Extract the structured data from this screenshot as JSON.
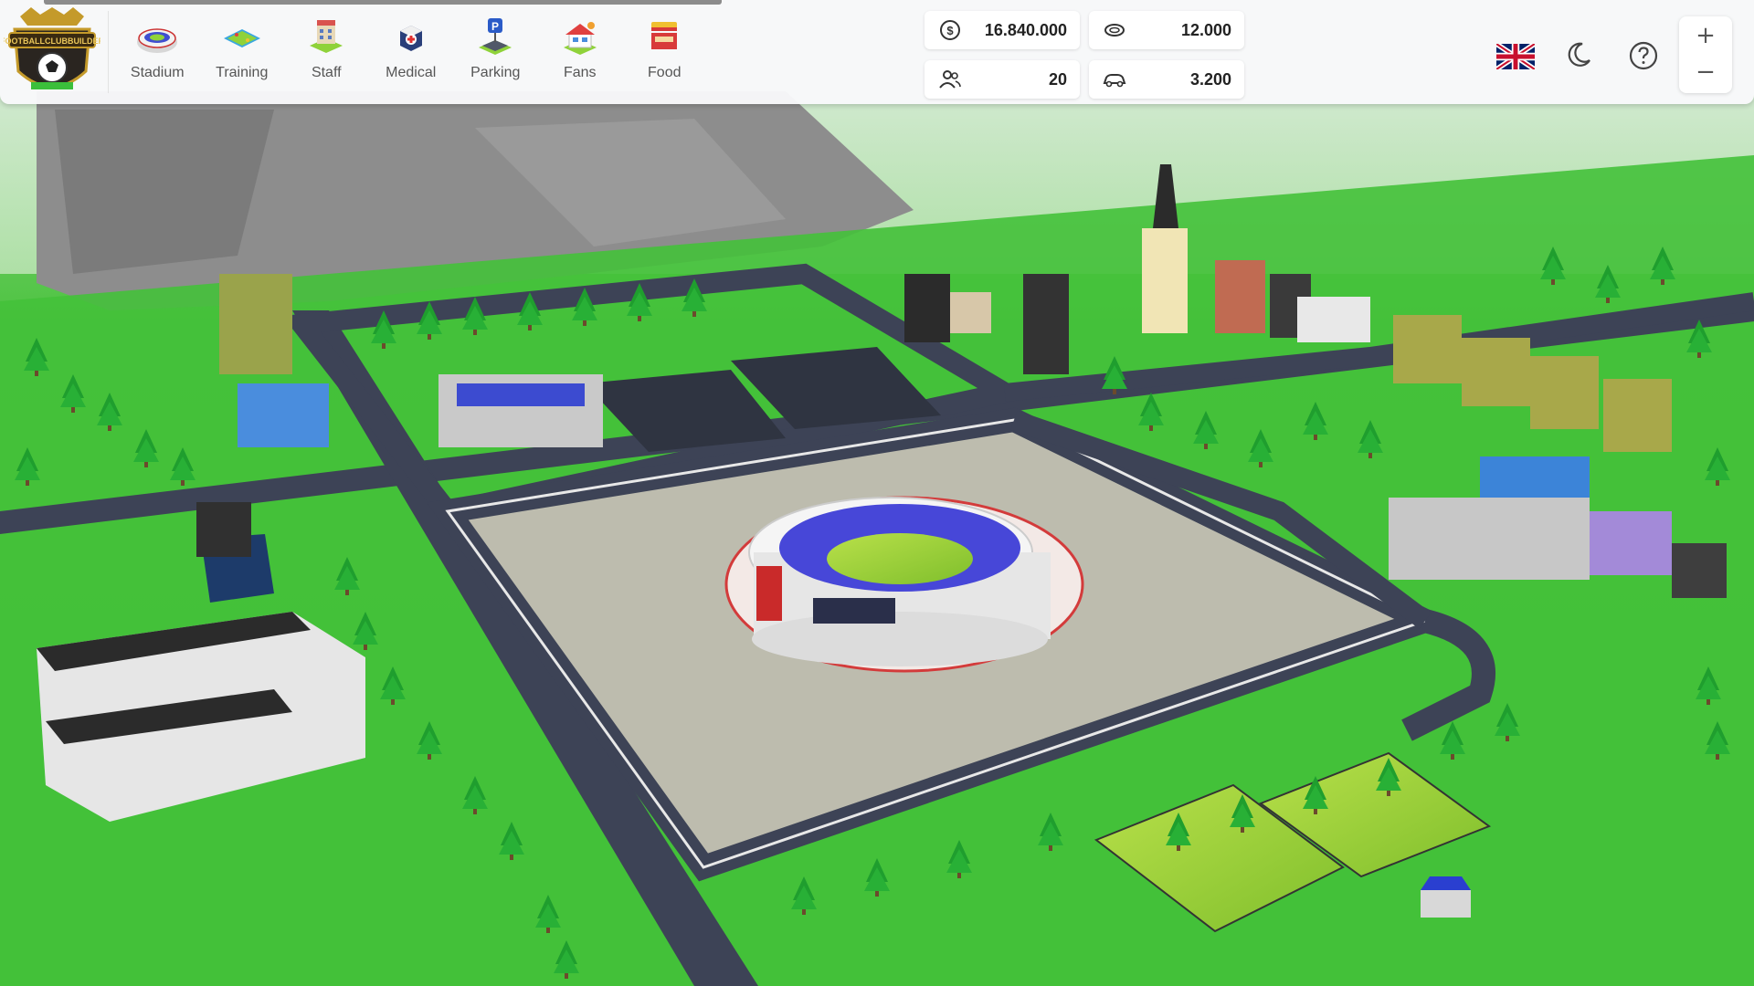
{
  "toolbar": {
    "logo_text": "FOOTBALLCLUBBUILDER",
    "items": [
      {
        "label": "Stadium",
        "icon": "stadium-icon"
      },
      {
        "label": "Training",
        "icon": "training-pitch-icon"
      },
      {
        "label": "Staff",
        "icon": "staff-building-icon"
      },
      {
        "label": "Medical",
        "icon": "medical-icon"
      },
      {
        "label": "Parking",
        "icon": "parking-icon"
      },
      {
        "label": "Fans",
        "icon": "fans-house-icon"
      },
      {
        "label": "Food",
        "icon": "food-stand-icon"
      }
    ]
  },
  "stats": {
    "money": {
      "value": "16.840.000",
      "icon": "coin-icon"
    },
    "capacity": {
      "value": "12.000",
      "icon": "seats-icon"
    },
    "staff": {
      "value": "20",
      "icon": "people-icon"
    },
    "parking": {
      "value": "3.200",
      "icon": "car-icon"
    }
  },
  "controls": {
    "language": "flag-uk-icon",
    "theme": "moon-icon",
    "help": "help-icon",
    "zoom_in": "+",
    "zoom_out": "−"
  },
  "colors": {
    "grass": "#4fc440",
    "road": "#3d4356",
    "plaza": "#bdbcae",
    "stadium_seats": "#4747d8",
    "stadium_ring": "#d33b3b"
  }
}
